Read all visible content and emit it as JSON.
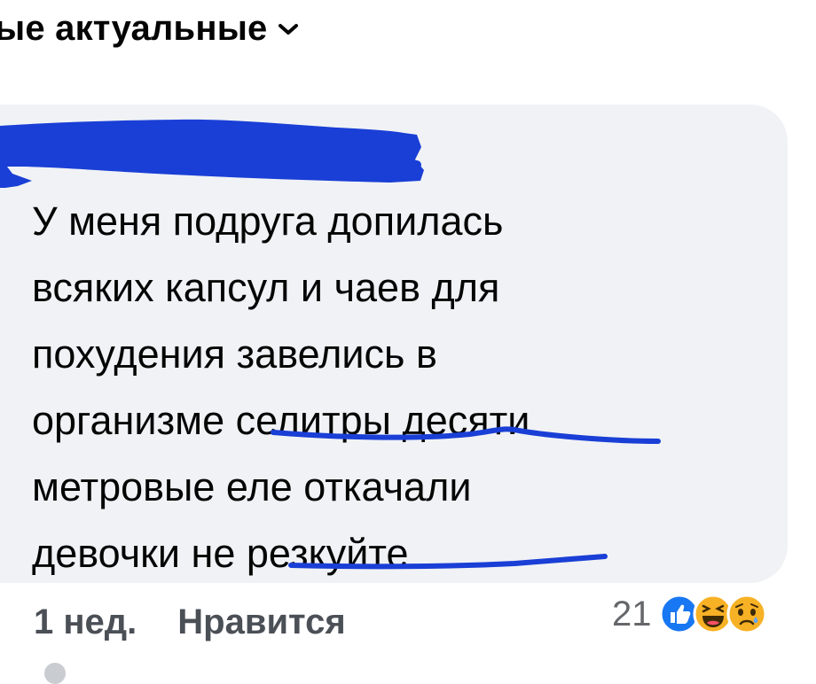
{
  "sort": {
    "label": "ые актуальные",
    "icon": "chevron-down-icon"
  },
  "comment": {
    "author_redacted": true,
    "redaction_color": "#1a3fd6",
    "lines": [
      "У меня подруга допилась",
      "всяких капсул и чаев для",
      "похудения завелись в",
      "организме селитры десяти",
      "метровые еле откачали",
      "девочки не резкуйте"
    ],
    "underlined_phrases": [
      "селитры десяти",
      "резкуйте"
    ],
    "bubble_color": "#f0f2f5"
  },
  "actions": {
    "time": "1 нед.",
    "like_label": "Нравится"
  },
  "reactions": {
    "count": "21",
    "icons": [
      "like-icon",
      "haha-icon",
      "sad-icon"
    ],
    "colors": {
      "like": "#1877f2",
      "haha": "#f7b125",
      "sad": "#f7b125"
    }
  }
}
